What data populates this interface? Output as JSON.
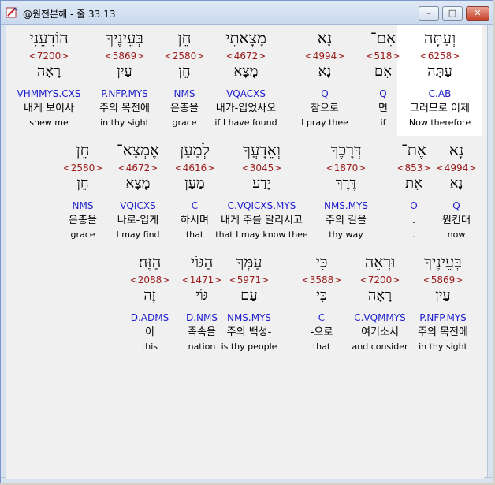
{
  "window": {
    "title": "@원전본해 - 줄 33:13",
    "minimize_label": "–",
    "maximize_label": "□",
    "close_label": "✕"
  },
  "rows": [
    {
      "words": [
        {
          "heb": "וְעַתָּה",
          "num": "<6258>",
          "lemma": "עַתָּה",
          "morph": "C.AB",
          "kor": "그러므로 이제",
          "eng": "Now therefore",
          "selected": true
        },
        {
          "heb": "אִם־",
          "num": "<518>",
          "lemma": "אִם",
          "morph": "Q",
          "kor": "면",
          "eng": "if"
        },
        {
          "heb": "נָא",
          "num": "<4994>",
          "lemma": "נָא",
          "morph": "Q",
          "kor": "참으로",
          "eng": "I pray thee"
        },
        {
          "heb": "מָצָאתִי",
          "num": "<4672>",
          "lemma": "מָצָא",
          "morph": "VQACXS",
          "kor": "내가-입었사오",
          "eng": "if I have found"
        },
        {
          "heb": "חֵן",
          "num": "<2580>",
          "lemma": "חֵן",
          "morph": "NMS",
          "kor": "은총을",
          "eng": "grace"
        },
        {
          "heb": "בְּעֵינֶיךָ",
          "num": "<5869>",
          "lemma": "עַיִן",
          "morph": "P.NFP.MYS",
          "kor": "주의 목전에",
          "eng": "in thy sight"
        },
        {
          "heb": "הוֹדִעֵנִי",
          "num": "<7200>",
          "lemma": "רָאָה",
          "morph": "VHMMYS.CXS",
          "kor": "내게 보이사",
          "eng": "shew me"
        }
      ]
    },
    {
      "words": [
        {
          "heb": "נָא",
          "num": "<4994>",
          "lemma": "נָא",
          "morph": "Q",
          "kor": "원컨대",
          "eng": "now"
        },
        {
          "heb": "אֶת־",
          "num": "<853>",
          "lemma": "אֵת",
          "morph": "O",
          "kor": ".",
          "eng": "."
        },
        {
          "heb": "דְּרָכֶךָ",
          "num": "<1870>",
          "lemma": "דֶּרֶךְ",
          "morph": "NMS.MYS",
          "kor": "주의 길을",
          "eng": "thy way"
        },
        {
          "heb": "וְאֵדָעֲךָ",
          "num": "<3045>",
          "lemma": "יָדַע",
          "morph": "C.VQICXS.MYS",
          "kor": "내게 주를 알리시고",
          "eng": "that I may know thee"
        },
        {
          "heb": "לְמַעַן",
          "num": "<4616>",
          "lemma": "מַעַן",
          "morph": "C",
          "kor": "하시며",
          "eng": "that"
        },
        {
          "heb": "אֶמְצָא־",
          "num": "<4672>",
          "lemma": "מָצָא",
          "morph": "VQICXS",
          "kor": "나로-입게",
          "eng": "I may find"
        },
        {
          "heb": "חֵן",
          "num": "<2580>",
          "lemma": "חֵן",
          "morph": "NMS",
          "kor": "은총을",
          "eng": "grace"
        }
      ]
    },
    {
      "words": [
        {
          "heb": "בְּעֵינֶיךָ",
          "num": "<5869>",
          "lemma": "עַיִן",
          "morph": "P.NFP.MYS",
          "kor": "주의 목전에",
          "eng": "in thy sight"
        },
        {
          "heb": "וּרְאֵה",
          "num": "<7200>",
          "lemma": "רָאָה",
          "morph": "C.VQMMYS",
          "kor": "여기소서",
          "eng": "and consider"
        },
        {
          "heb": "כִּי",
          "num": "<3588>",
          "lemma": "כִּי",
          "morph": "C",
          "kor": "-으로",
          "eng": "that"
        },
        {
          "heb": "עַמְּךָ",
          "num": "<5971>",
          "lemma": "עַם",
          "morph": "NMS.MYS",
          "kor": "주의 백성-",
          "eng": "is thy people"
        },
        {
          "heb": "הַגּוֹי",
          "num": "<1471>",
          "lemma": "גּוֹי",
          "morph": "D.NMS",
          "kor": "족속을",
          "eng": "nation"
        },
        {
          "heb": "הַזֶּה׃",
          "num": "<2088>",
          "lemma": "זֶה",
          "morph": "D.ADMS",
          "kor": "이",
          "eng": "this"
        }
      ]
    }
  ]
}
